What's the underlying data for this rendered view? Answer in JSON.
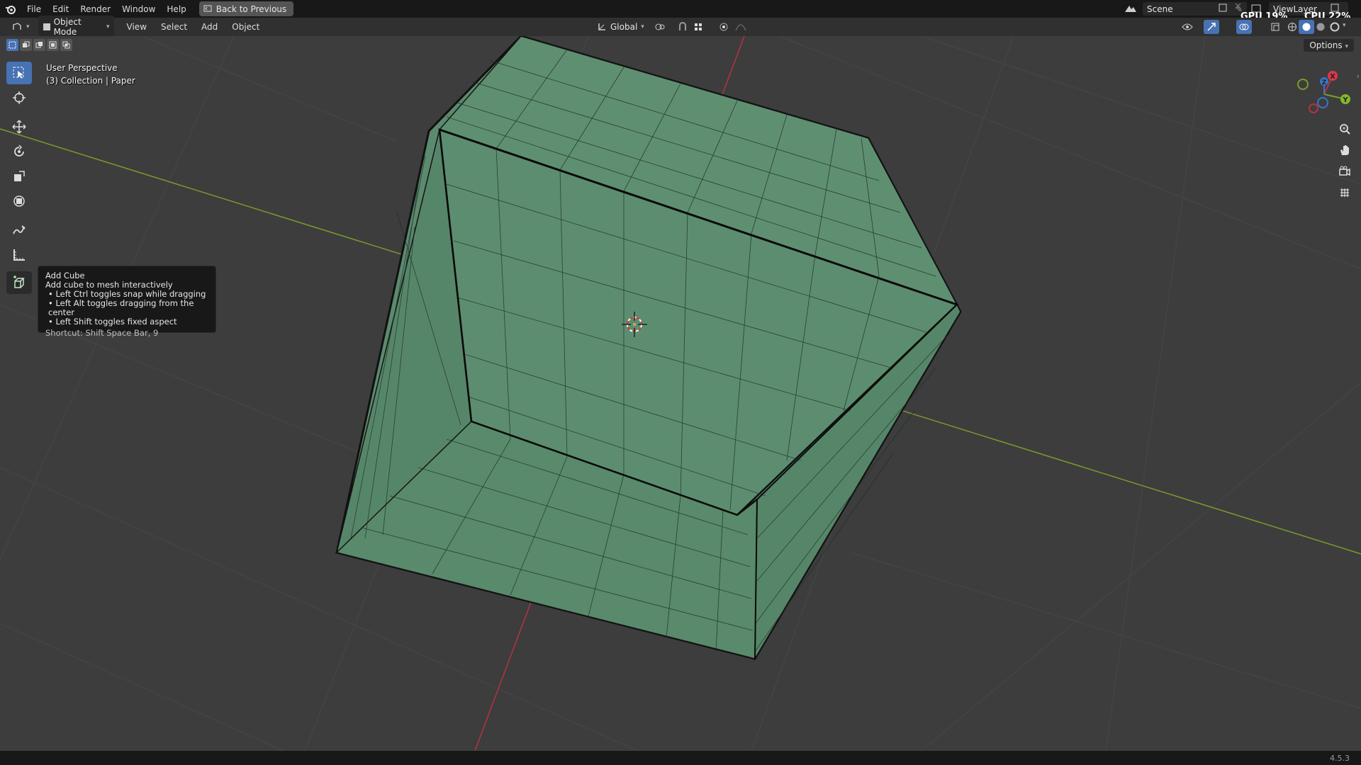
{
  "topbar": {
    "menus": [
      "File",
      "Edit",
      "Render",
      "Window",
      "Help"
    ],
    "back_label": "Back to Previous",
    "scene_label": "Scene",
    "viewlayer_label": "ViewLayer",
    "gpu_label": "GPU",
    "gpu_value": "19%",
    "cpu_label": "CPU",
    "cpu_value": "22%"
  },
  "header": {
    "mode_label": "Object Mode",
    "menus": [
      "View",
      "Select",
      "Add",
      "Object"
    ],
    "orientation_label": "Global"
  },
  "viewport": {
    "perspective_label": "User Perspective",
    "collection_label": "(3) Collection | Paper",
    "options_label": "Options",
    "gizmo": {
      "x_label": "X",
      "y_label": "Y",
      "z_label": "Z"
    }
  },
  "tooltip": {
    "title": "Add Cube",
    "description": "Add cube to mesh interactively",
    "hints": [
      "• Left Ctrl toggles snap while dragging",
      "• Left Alt toggles dragging from the center",
      "• Left Shift toggles fixed aspect"
    ],
    "shortcut": "Shortcut: Shift Space Bar, 9"
  },
  "statusbar": {
    "version": "4.5.3"
  },
  "colors": {
    "accent": "#4772b3",
    "mesh_fill": "#5b8a6e",
    "x_axis": "#b5333f",
    "y_axis": "#7a9c2a"
  }
}
